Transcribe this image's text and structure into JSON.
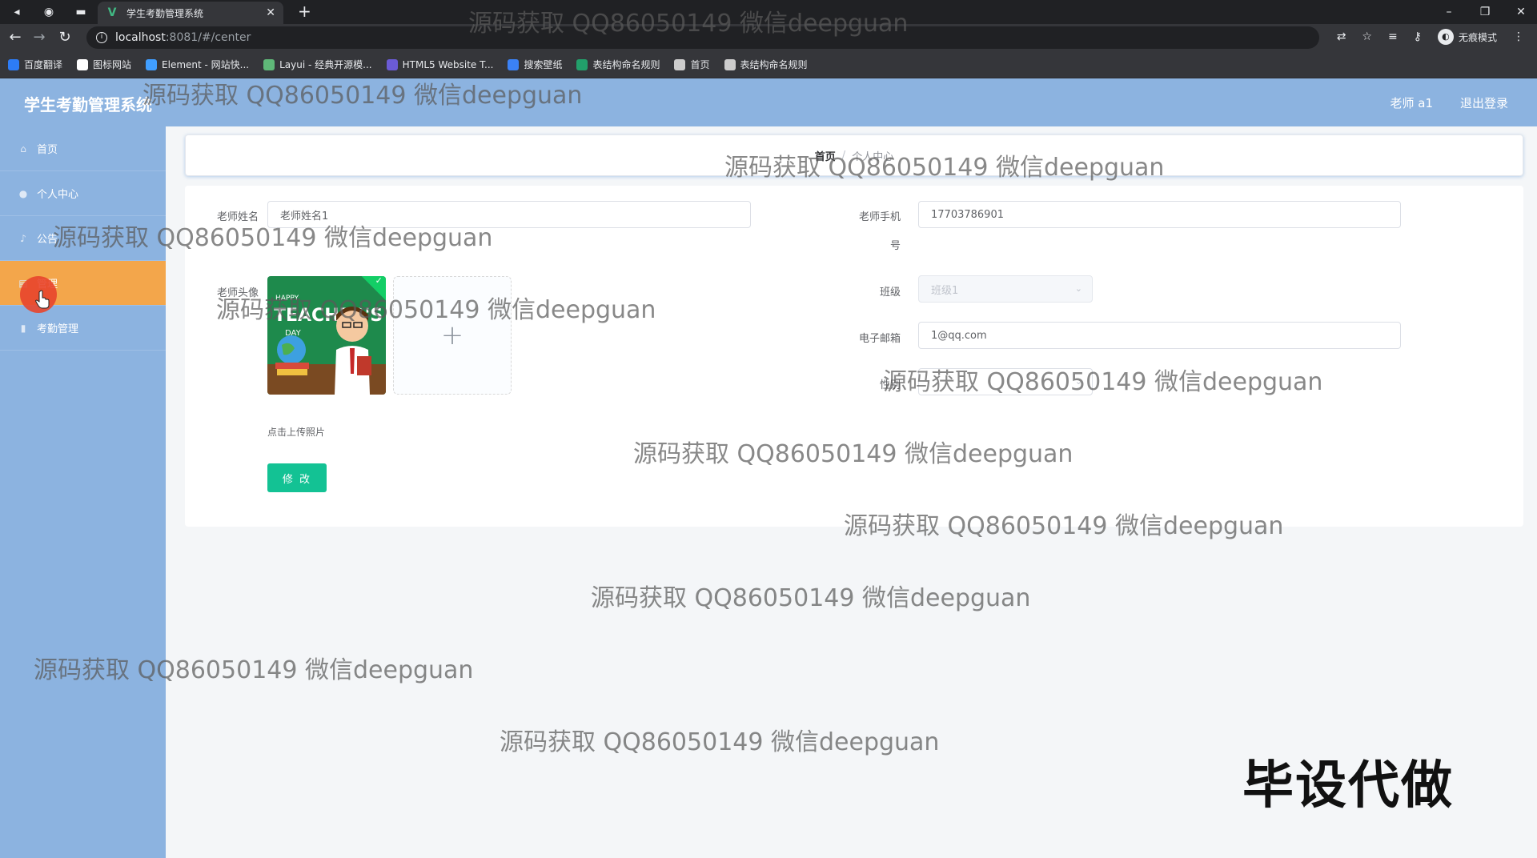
{
  "browser": {
    "tab_title": "学生考勤管理系统",
    "url_host": "localhost",
    "url_rest": ":8081/#/center",
    "incognito_label": "无痕模式",
    "bookmarks": [
      {
        "label": "百度翻译",
        "color": "#2d7cf6"
      },
      {
        "label": "图标网站",
        "color": "#ffffff"
      },
      {
        "label": "Element - 网站快...",
        "color": "#409eff"
      },
      {
        "label": "Layui - 经典开源模...",
        "color": "#5fb878"
      },
      {
        "label": "HTML5 Website T...",
        "color": "#6b5bd6"
      },
      {
        "label": "搜索壁纸",
        "color": "#3b82f6"
      },
      {
        "label": "表结构命名规则",
        "color": "#22a06b"
      },
      {
        "label": "首页",
        "color": "#cccccc"
      },
      {
        "label": "表结构命名规则",
        "color": "#cccccc"
      }
    ]
  },
  "header": {
    "title": "学生考勤管理系统",
    "user": "老师 a1",
    "logout": "退出登录"
  },
  "sidebar": {
    "items": [
      {
        "label": "首页",
        "icon": "home-icon"
      },
      {
        "label": "个人中心",
        "icon": "user-icon"
      },
      {
        "label": "公告",
        "icon": "bell-icon"
      },
      {
        "label": "管理",
        "icon": "folder-icon",
        "active": true
      },
      {
        "label": "考勤管理",
        "icon": "chart-icon"
      }
    ]
  },
  "breadcrumb": {
    "home": "首页",
    "separator": "/",
    "current": "个人中心"
  },
  "form": {
    "name_label": "老师姓名",
    "name_value": "老师姓名1",
    "phone_label_1": "老师手机",
    "phone_label_2": "号",
    "phone_value": "17703786901",
    "avatar_label": "老师头像",
    "class_label": "班级",
    "class_value": "班级1",
    "email_label": "电子邮箱",
    "email_value": "1@qq.com",
    "gender_label": "性别",
    "upload_tip": "点击上传照片",
    "submit": "修 改"
  },
  "overlay": {
    "watermark": "源码获取 QQ86050149 微信deepguan",
    "badge": "毕设代做"
  },
  "colors": {
    "sidebar": "#8cb3e0",
    "active": "#f3a64b",
    "button": "#13c294"
  }
}
